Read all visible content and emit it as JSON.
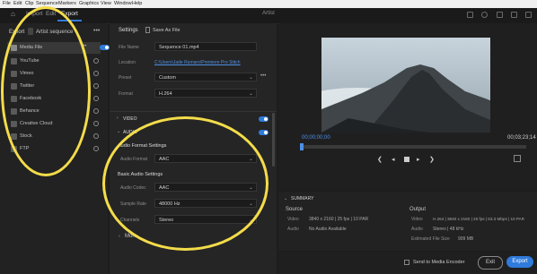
{
  "menu": [
    "File",
    "Edit",
    "Clip",
    "Sequence",
    "Markers",
    "Graphics",
    "View",
    "Window",
    "Help"
  ],
  "tabs": {
    "home": "⌂",
    "import": "Import",
    "edit": "Edit",
    "export": "Export"
  },
  "header_title": "Artist",
  "left": {
    "export_label": "Export",
    "sequence_label": "Artist sequence",
    "more_label": "•••",
    "destinations": [
      "Media File",
      "YouTube",
      "Vimeo",
      "Twitter",
      "Facebook",
      "Behance",
      "Creative Cloud",
      "Stock",
      "FTP"
    ]
  },
  "settings": {
    "title": "Settings",
    "save_as_file": "Save As File",
    "file_name_label": "File Name",
    "file_name_value": "Sequence 01.mp4",
    "location_label": "Location",
    "location_value": "C:\\Users\\Jade Rumaro\\Premiere Pro Stitch",
    "preset_label": "Preset",
    "preset_value": "Custom",
    "format_label": "Format",
    "format_value": "H.264",
    "video_section": "VIDEO",
    "audio_section": "AUDIO",
    "audio_format_settings": "Audio Format Settings",
    "audio_format_label": "Audio Format",
    "audio_format_value": "AAC",
    "basic_audio_settings": "Basic Audio Settings",
    "audio_codec_label": "Audio Codec",
    "audio_codec_value": "AAC",
    "sample_rate_label": "Sample Rate",
    "sample_rate_value": "48000 Hz",
    "channels_label": "Channels",
    "channels_value": "Stereo",
    "more_label": "More"
  },
  "preview": {
    "timecode_start": "00;00;00;00",
    "timecode_end": "00;03;23;14"
  },
  "summary": {
    "title": "SUMMARY",
    "source_label": "Source",
    "output_label": "Output",
    "src_video_label": "Video",
    "src_video_value": "3840 x 2160  |  25 fps  |  10 PAR",
    "src_audio_label": "Audio",
    "src_audio_value": "No Audio Available",
    "out_video_label": "Video",
    "out_video_value": "H.264  |  3840 x 2160  |  25 fps  |  63.3 Mbps  |  10 PAR",
    "out_audio_label": "Audio",
    "out_audio_value": "Stereo  |  48 kHz",
    "est_size_label": "Estimated File Size",
    "est_size_value": "909 MB"
  },
  "footer": {
    "send_label": "Send to Media Encoder",
    "exit_label": "Exit",
    "export_label": "Export"
  },
  "colors": {
    "accent": "#2f7bdc",
    "highlight": "#f3dc4a"
  }
}
